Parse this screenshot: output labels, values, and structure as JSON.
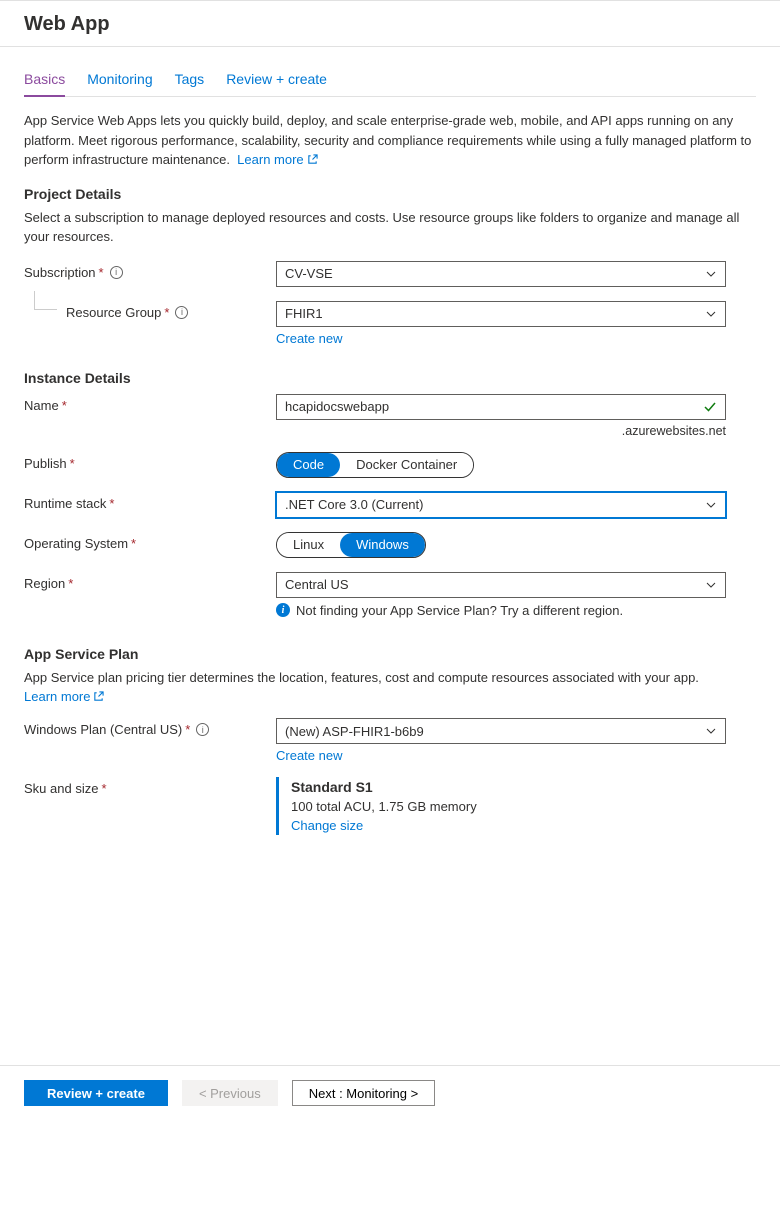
{
  "header": {
    "title": "Web App"
  },
  "tabs": [
    {
      "label": "Basics",
      "active": true
    },
    {
      "label": "Monitoring",
      "active": false
    },
    {
      "label": "Tags",
      "active": false
    },
    {
      "label": "Review + create",
      "active": false
    }
  ],
  "intro": {
    "text": "App Service Web Apps lets you quickly build, deploy, and scale enterprise-grade web, mobile, and API apps running on any platform. Meet rigorous performance, scalability, security and compliance requirements while using a fully managed platform to perform infrastructure maintenance.",
    "learn_more": "Learn more"
  },
  "project_details": {
    "title": "Project Details",
    "desc": "Select a subscription to manage deployed resources and costs. Use resource groups like folders to organize and manage all your resources.",
    "subscription_label": "Subscription",
    "subscription_value": "CV-VSE",
    "resource_group_label": "Resource Group",
    "resource_group_value": "FHIR1",
    "create_new": "Create new"
  },
  "instance_details": {
    "title": "Instance Details",
    "name_label": "Name",
    "name_value": "hcapidocswebapp",
    "name_suffix": ".azurewebsites.net",
    "publish_label": "Publish",
    "publish_options": [
      "Code",
      "Docker Container"
    ],
    "publish_selected": "Code",
    "runtime_label": "Runtime stack",
    "runtime_value": ".NET Core 3.0 (Current)",
    "os_label": "Operating System",
    "os_options": [
      "Linux",
      "Windows"
    ],
    "os_selected": "Windows",
    "region_label": "Region",
    "region_value": "Central US",
    "region_hint": "Not finding your App Service Plan? Try a different region."
  },
  "app_service_plan": {
    "title": "App Service Plan",
    "desc": "App Service plan pricing tier determines the location, features, cost and compute resources associated with your app.",
    "learn_more": "Learn more",
    "plan_label": "Windows Plan (Central US)",
    "plan_value": "(New) ASP-FHIR1-b6b9",
    "create_new": "Create new",
    "sku_label": "Sku and size",
    "sku_name": "Standard S1",
    "sku_spec": "100 total ACU, 1.75 GB memory",
    "change_size": "Change size"
  },
  "footer": {
    "review": "Review + create",
    "previous": "< Previous",
    "next": "Next : Monitoring >"
  }
}
